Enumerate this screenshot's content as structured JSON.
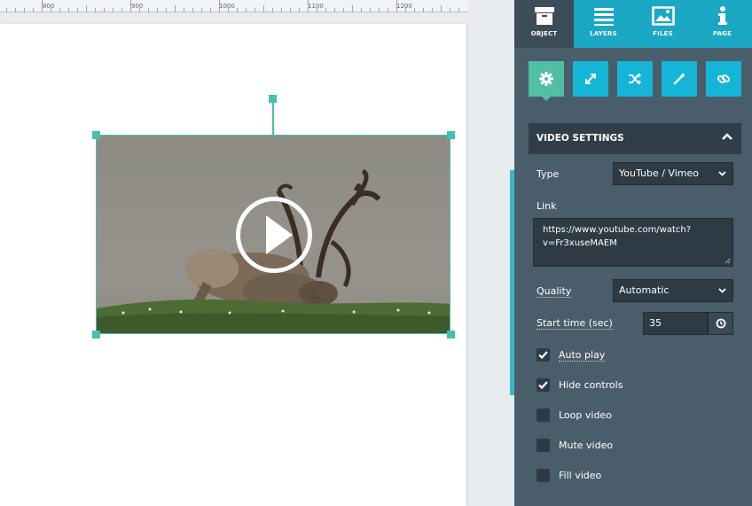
{
  "ruler": {
    "labels": [
      "800",
      "900",
      "1000",
      "1100",
      "1200"
    ]
  },
  "tabs": [
    {
      "label": "OBJECT",
      "icon": "object-icon",
      "active": true
    },
    {
      "label": "LAYERS",
      "icon": "layers-icon",
      "active": false
    },
    {
      "label": "FILES",
      "icon": "files-icon",
      "active": false
    },
    {
      "label": "PAGE",
      "icon": "page-icon",
      "active": false
    }
  ],
  "tools": [
    {
      "icon": "gear-icon",
      "active": true
    },
    {
      "icon": "resize-icon",
      "active": false
    },
    {
      "icon": "shuffle-icon",
      "active": false
    },
    {
      "icon": "magic-wand-icon",
      "active": false
    },
    {
      "icon": "link-icon",
      "active": false
    }
  ],
  "settings": {
    "title": "VIDEO SETTINGS",
    "type_label": "Type",
    "type_value": "YouTube / Vimeo",
    "link_label": "Link",
    "link_value": "https://www.youtube.com/watch?v=Fr3xuseMAEM",
    "link_line1": "https://www.youtube.com/watch?",
    "link_line2": "v=Fr3xuseMAEM",
    "quality_label": "Quality",
    "quality_value": "Automatic",
    "start_label": "Start time (sec)",
    "start_value": "35"
  },
  "options": [
    {
      "label": "Auto play",
      "checked": true
    },
    {
      "label": "Hide controls",
      "checked": true
    },
    {
      "label": "Loop video",
      "checked": false
    },
    {
      "label": "Mute video",
      "checked": false
    },
    {
      "label": "Fill video",
      "checked": false
    }
  ],
  "colors": {
    "accent": "#43c0b2",
    "tab_bar": "#1aa8c4",
    "panel": "#4a5d6b",
    "section_head": "#2f3e49",
    "tool_active": "#50bfa6",
    "tool": "#14b5d6"
  }
}
